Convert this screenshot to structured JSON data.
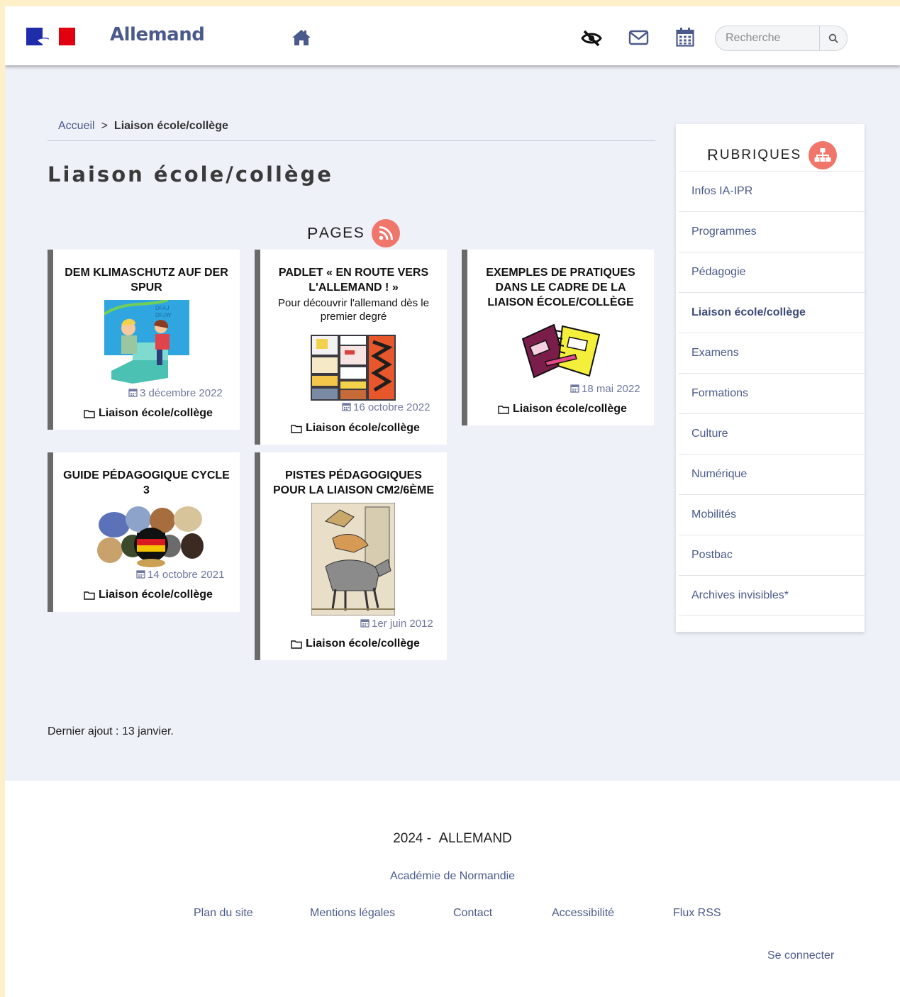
{
  "header": {
    "site_title": "Allemand",
    "search_placeholder": "Recherche"
  },
  "breadcrumb": {
    "home": "Accueil",
    "separator": ">",
    "current": "Liaison école/collège"
  },
  "page_title": "Liaison école/collège",
  "pages_heading": {
    "first": "P",
    "rest": "AGES"
  },
  "cards": [
    {
      "title": "Dem Klimaschutz auf der Spur",
      "subtitle": "",
      "date": "3 décembre 2022",
      "category": "Liaison école/collège"
    },
    {
      "title": "Padlet « En route vers l'allemand ! »",
      "subtitle": "Pour découvrir l'allemand dès le premier degré",
      "date": "16 octobre 2022",
      "category": "Liaison école/collège"
    },
    {
      "title": "Exemples de pratiques dans le cadre de la liaison école/collège",
      "subtitle": "",
      "date": "18 mai 2022",
      "category": "Liaison école/collège"
    },
    {
      "title": "Guide pédagogique cycle 3",
      "subtitle": "",
      "date": "14 octobre 2021",
      "category": "Liaison école/collège"
    },
    {
      "title": "Pistes pédagogiques pour la liaison CM2/6ème",
      "subtitle": "",
      "date": "1er juin 2012",
      "category": "Liaison école/collège"
    }
  ],
  "sidebar": {
    "heading": {
      "first": "R",
      "rest": "UBRIQUES"
    },
    "items": [
      {
        "label": "Infos IA-IPR"
      },
      {
        "label": "Programmes"
      },
      {
        "label": "Pédagogie"
      },
      {
        "label": "Liaison école/collège"
      },
      {
        "label": "Examens"
      },
      {
        "label": "Formations"
      },
      {
        "label": "Culture"
      },
      {
        "label": "Numérique"
      },
      {
        "label": "Mobilités"
      },
      {
        "label": "Postbac"
      },
      {
        "label": "Archives invisibles*"
      }
    ]
  },
  "last_added": "Dernier ajout : 13 janvier.",
  "footer": {
    "year": "2024 -",
    "site_first": "A",
    "site_rest": "LLEMAND",
    "academy": "Académie de Normandie",
    "links": [
      {
        "label": "Plan du site"
      },
      {
        "label": "Mentions légales"
      },
      {
        "label": "Contact"
      },
      {
        "label": "Accessibilité"
      },
      {
        "label": "Flux RSS"
      }
    ],
    "login": "Se connecter"
  },
  "colors": {
    "accent": "#f0756a",
    "link": "#4b5a8c",
    "page_bg": "#eef1f8",
    "outer_bg": "#fdf0c8",
    "card_border": "#6a6a6a"
  },
  "icons": [
    "home-icon",
    "eye-slash-icon",
    "mail-icon",
    "calendar-icon",
    "search-icon",
    "rss-icon",
    "sitemap-icon",
    "folder-icon"
  ]
}
